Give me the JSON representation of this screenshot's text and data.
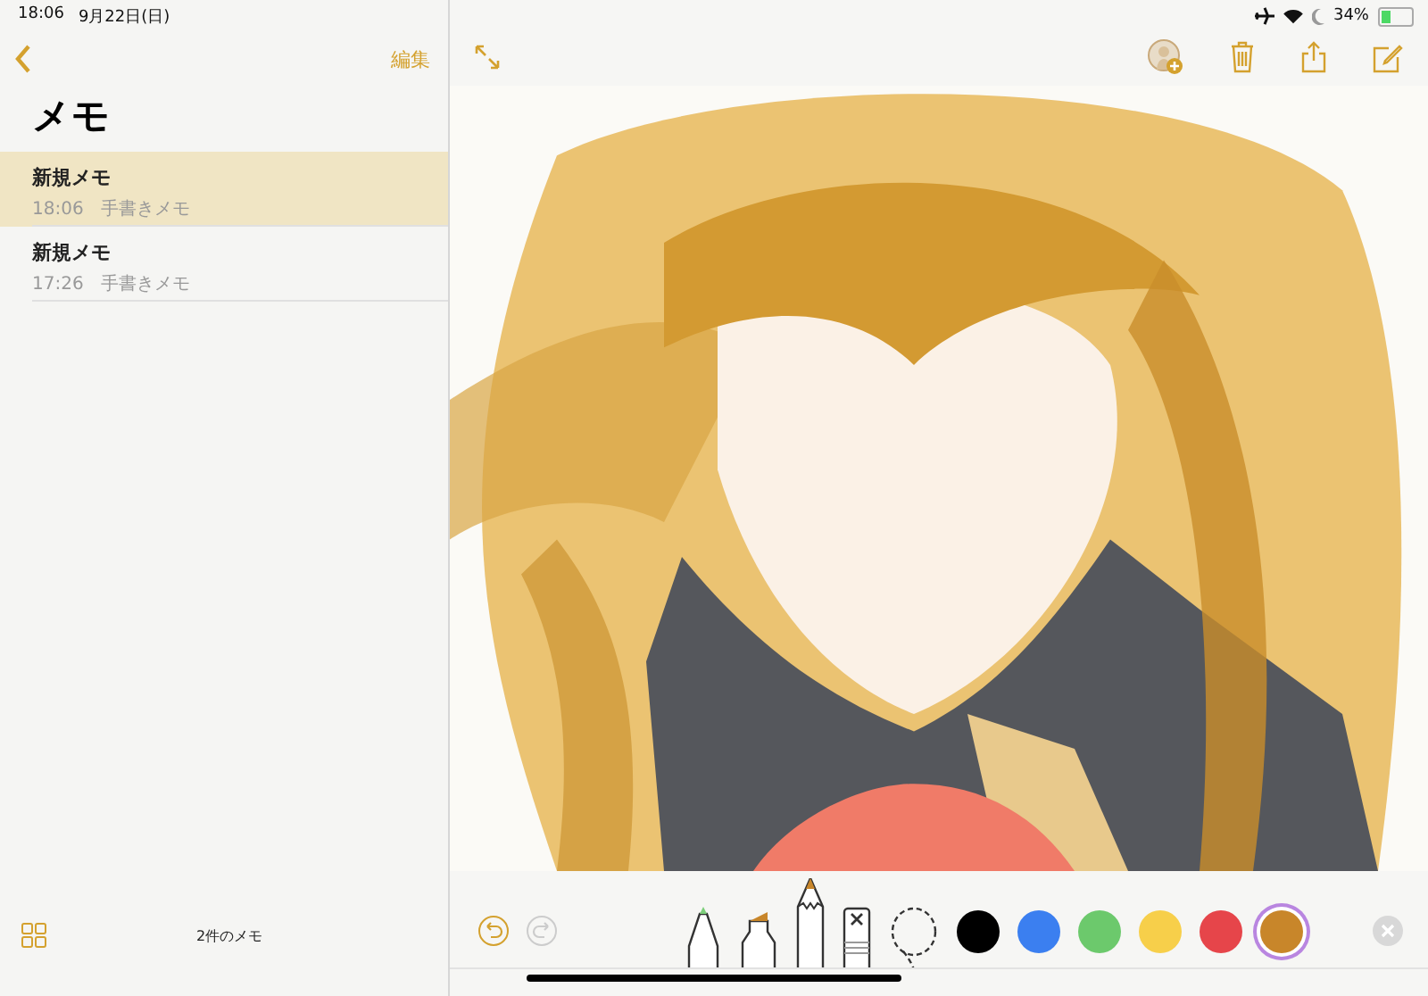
{
  "status_bar": {
    "time": "18:06",
    "date": "9月22日(日)",
    "battery": "34%"
  },
  "sidebar": {
    "edit_label": "編集",
    "title": "メモ",
    "notes": [
      {
        "title": "新規メモ",
        "time": "18:06",
        "kind_label": "手書きメモ",
        "selected": true
      },
      {
        "title": "新規メモ",
        "time": "17:26",
        "kind_label": "手書きメモ",
        "selected": false
      }
    ],
    "footer_count": "2件のメモ"
  },
  "drawing_tools": {
    "undo_disabled": false,
    "redo_disabled": true,
    "tools": [
      {
        "kind": "pen",
        "selected": false,
        "color": "#7ccf7a"
      },
      {
        "kind": "marker",
        "selected": false,
        "color": "#c8862a"
      },
      {
        "kind": "pencil",
        "selected": true,
        "color": "#c8862a"
      },
      {
        "kind": "eraser",
        "selected": false
      },
      {
        "kind": "lasso",
        "selected": false
      }
    ],
    "colors": [
      {
        "color": "#000000",
        "selected": false
      },
      {
        "color": "#3b7ff0",
        "selected": false
      },
      {
        "color": "#6cc96c",
        "selected": false
      },
      {
        "color": "#f7cf4a",
        "selected": false
      },
      {
        "color": "#e6454a",
        "selected": false
      },
      {
        "color": "#c8862a",
        "selected": true
      }
    ]
  }
}
